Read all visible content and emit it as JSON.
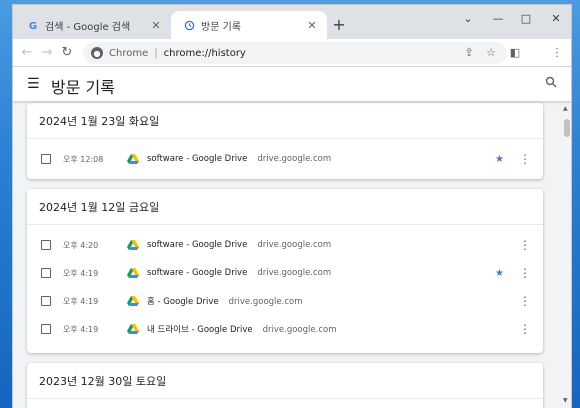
{
  "tabs": [
    {
      "title": "검색 - Google 검색",
      "favicon": "google-icon"
    },
    {
      "title": "방문 기록",
      "favicon": "history-icon"
    }
  ],
  "new_tab": "+",
  "window_controls": {
    "chevron": "⌄",
    "minimize": "—",
    "maximize": "□",
    "close": "✕"
  },
  "omnibox": {
    "origin": "Chrome",
    "separator": "|",
    "url": "chrome://history"
  },
  "page_title": "방문 기록",
  "days": [
    {
      "title": "2024년 1월 23일 화요일",
      "entries": [
        {
          "time": "오후 12:08",
          "title": "software - Google Drive",
          "domain": "drive.google.com",
          "starred": true
        }
      ]
    },
    {
      "title": "2024년 1월 12일 금요일",
      "entries": [
        {
          "time": "오후 4:20",
          "title": "software - Google Drive",
          "domain": "drive.google.com",
          "starred": false
        },
        {
          "time": "오후 4:19",
          "title": "software - Google Drive",
          "domain": "drive.google.com",
          "starred": true
        },
        {
          "time": "오후 4:19",
          "title": "홈 - Google Drive",
          "domain": "drive.google.com",
          "starred": false
        },
        {
          "time": "오후 4:19",
          "title": "내 드라이브 - Google Drive",
          "domain": "drive.google.com",
          "starred": false
        }
      ]
    },
    {
      "title": "2023년 12월 30일 토요일",
      "entries": []
    }
  ],
  "colors": {
    "star": "#4a78c8",
    "accent": "#1a73e8"
  }
}
